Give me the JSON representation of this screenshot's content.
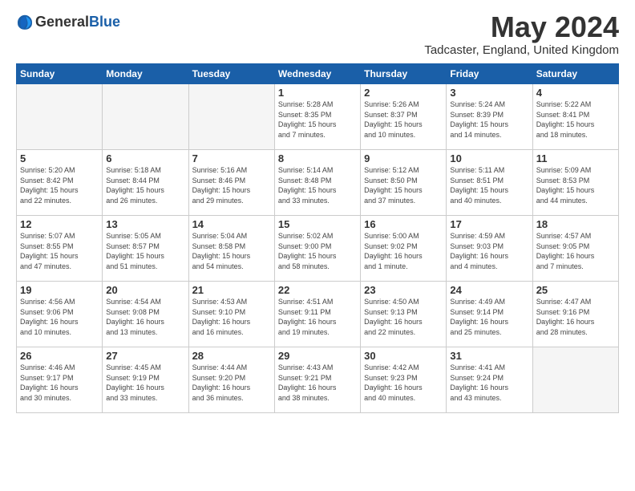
{
  "header": {
    "logo_general": "General",
    "logo_blue": "Blue",
    "month_title": "May 2024",
    "location": "Tadcaster, England, United Kingdom"
  },
  "days_of_week": [
    "Sunday",
    "Monday",
    "Tuesday",
    "Wednesday",
    "Thursday",
    "Friday",
    "Saturday"
  ],
  "weeks": [
    [
      {
        "day": "",
        "info": ""
      },
      {
        "day": "",
        "info": ""
      },
      {
        "day": "",
        "info": ""
      },
      {
        "day": "1",
        "info": "Sunrise: 5:28 AM\nSunset: 8:35 PM\nDaylight: 15 hours\nand 7 minutes."
      },
      {
        "day": "2",
        "info": "Sunrise: 5:26 AM\nSunset: 8:37 PM\nDaylight: 15 hours\nand 10 minutes."
      },
      {
        "day": "3",
        "info": "Sunrise: 5:24 AM\nSunset: 8:39 PM\nDaylight: 15 hours\nand 14 minutes."
      },
      {
        "day": "4",
        "info": "Sunrise: 5:22 AM\nSunset: 8:41 PM\nDaylight: 15 hours\nand 18 minutes."
      }
    ],
    [
      {
        "day": "5",
        "info": "Sunrise: 5:20 AM\nSunset: 8:42 PM\nDaylight: 15 hours\nand 22 minutes."
      },
      {
        "day": "6",
        "info": "Sunrise: 5:18 AM\nSunset: 8:44 PM\nDaylight: 15 hours\nand 26 minutes."
      },
      {
        "day": "7",
        "info": "Sunrise: 5:16 AM\nSunset: 8:46 PM\nDaylight: 15 hours\nand 29 minutes."
      },
      {
        "day": "8",
        "info": "Sunrise: 5:14 AM\nSunset: 8:48 PM\nDaylight: 15 hours\nand 33 minutes."
      },
      {
        "day": "9",
        "info": "Sunrise: 5:12 AM\nSunset: 8:50 PM\nDaylight: 15 hours\nand 37 minutes."
      },
      {
        "day": "10",
        "info": "Sunrise: 5:11 AM\nSunset: 8:51 PM\nDaylight: 15 hours\nand 40 minutes."
      },
      {
        "day": "11",
        "info": "Sunrise: 5:09 AM\nSunset: 8:53 PM\nDaylight: 15 hours\nand 44 minutes."
      }
    ],
    [
      {
        "day": "12",
        "info": "Sunrise: 5:07 AM\nSunset: 8:55 PM\nDaylight: 15 hours\nand 47 minutes."
      },
      {
        "day": "13",
        "info": "Sunrise: 5:05 AM\nSunset: 8:57 PM\nDaylight: 15 hours\nand 51 minutes."
      },
      {
        "day": "14",
        "info": "Sunrise: 5:04 AM\nSunset: 8:58 PM\nDaylight: 15 hours\nand 54 minutes."
      },
      {
        "day": "15",
        "info": "Sunrise: 5:02 AM\nSunset: 9:00 PM\nDaylight: 15 hours\nand 58 minutes."
      },
      {
        "day": "16",
        "info": "Sunrise: 5:00 AM\nSunset: 9:02 PM\nDaylight: 16 hours\nand 1 minute."
      },
      {
        "day": "17",
        "info": "Sunrise: 4:59 AM\nSunset: 9:03 PM\nDaylight: 16 hours\nand 4 minutes."
      },
      {
        "day": "18",
        "info": "Sunrise: 4:57 AM\nSunset: 9:05 PM\nDaylight: 16 hours\nand 7 minutes."
      }
    ],
    [
      {
        "day": "19",
        "info": "Sunrise: 4:56 AM\nSunset: 9:06 PM\nDaylight: 16 hours\nand 10 minutes."
      },
      {
        "day": "20",
        "info": "Sunrise: 4:54 AM\nSunset: 9:08 PM\nDaylight: 16 hours\nand 13 minutes."
      },
      {
        "day": "21",
        "info": "Sunrise: 4:53 AM\nSunset: 9:10 PM\nDaylight: 16 hours\nand 16 minutes."
      },
      {
        "day": "22",
        "info": "Sunrise: 4:51 AM\nSunset: 9:11 PM\nDaylight: 16 hours\nand 19 minutes."
      },
      {
        "day": "23",
        "info": "Sunrise: 4:50 AM\nSunset: 9:13 PM\nDaylight: 16 hours\nand 22 minutes."
      },
      {
        "day": "24",
        "info": "Sunrise: 4:49 AM\nSunset: 9:14 PM\nDaylight: 16 hours\nand 25 minutes."
      },
      {
        "day": "25",
        "info": "Sunrise: 4:47 AM\nSunset: 9:16 PM\nDaylight: 16 hours\nand 28 minutes."
      }
    ],
    [
      {
        "day": "26",
        "info": "Sunrise: 4:46 AM\nSunset: 9:17 PM\nDaylight: 16 hours\nand 30 minutes."
      },
      {
        "day": "27",
        "info": "Sunrise: 4:45 AM\nSunset: 9:19 PM\nDaylight: 16 hours\nand 33 minutes."
      },
      {
        "day": "28",
        "info": "Sunrise: 4:44 AM\nSunset: 9:20 PM\nDaylight: 16 hours\nand 36 minutes."
      },
      {
        "day": "29",
        "info": "Sunrise: 4:43 AM\nSunset: 9:21 PM\nDaylight: 16 hours\nand 38 minutes."
      },
      {
        "day": "30",
        "info": "Sunrise: 4:42 AM\nSunset: 9:23 PM\nDaylight: 16 hours\nand 40 minutes."
      },
      {
        "day": "31",
        "info": "Sunrise: 4:41 AM\nSunset: 9:24 PM\nDaylight: 16 hours\nand 43 minutes."
      },
      {
        "day": "",
        "info": ""
      }
    ]
  ]
}
